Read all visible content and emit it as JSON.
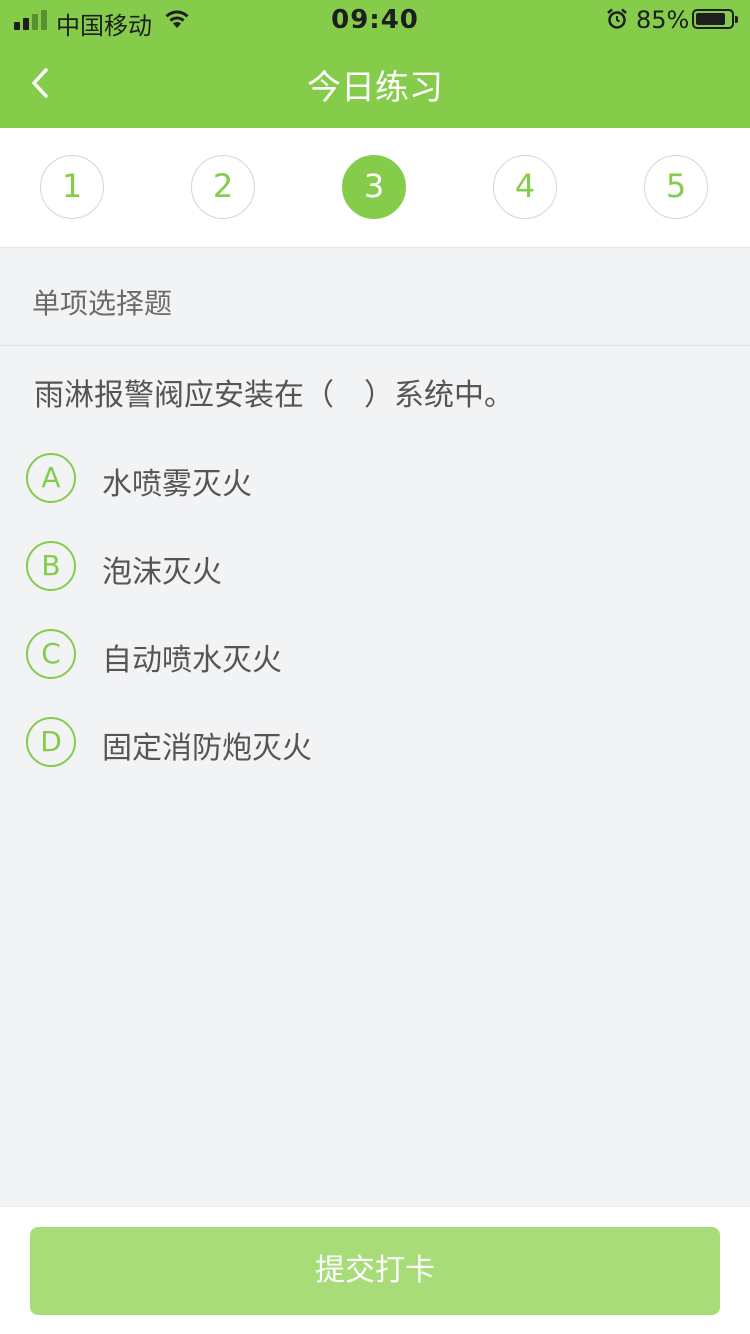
{
  "status_bar": {
    "carrier": "中国移动",
    "time": "09:40",
    "battery_percent": "85%",
    "battery_level": 0.85,
    "icons": [
      "signal-icon",
      "wifi-icon",
      "alarm-icon",
      "battery-icon"
    ]
  },
  "nav": {
    "back_icon": "chevron-left-icon",
    "title": "今日练习"
  },
  "steps": {
    "items": [
      "1",
      "2",
      "3",
      "4",
      "5"
    ],
    "active": "3"
  },
  "question": {
    "type_label": "单项选择题",
    "text": "雨淋报警阀应安装在（　）系统中。",
    "options": [
      {
        "letter": "A",
        "text": "水喷雾灭火"
      },
      {
        "letter": "B",
        "text": "泡沫灭火"
      },
      {
        "letter": "C",
        "text": "自动喷水灭火"
      },
      {
        "letter": "D",
        "text": "固定消防炮灭火"
      }
    ]
  },
  "footer": {
    "submit_label": "提交打卡"
  },
  "colors": {
    "accent": "#86cc4b",
    "submit_bg": "#a8dc79",
    "page_bg": "#f2f3f5"
  }
}
